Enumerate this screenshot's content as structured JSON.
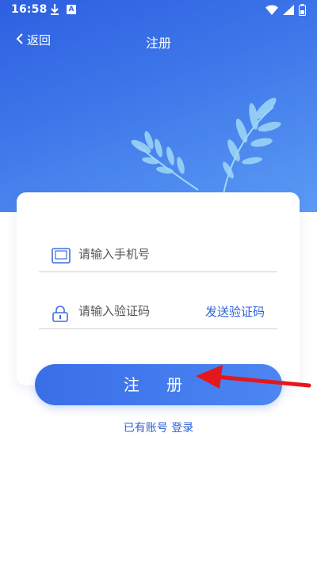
{
  "status_bar": {
    "time": "16:58"
  },
  "header": {
    "back_label": "返回",
    "title": "注册"
  },
  "form": {
    "phone_placeholder": "请输入手机号",
    "code_placeholder": "请输入验证码",
    "send_code_label": "发送验证码"
  },
  "submit": {
    "label": "注 册"
  },
  "footer": {
    "prompt": "已有账号",
    "login_label": "登录"
  },
  "colors": {
    "accent": "#2f62d8",
    "hero_start": "#2d5fe0",
    "hero_end": "#5b9bf4"
  }
}
